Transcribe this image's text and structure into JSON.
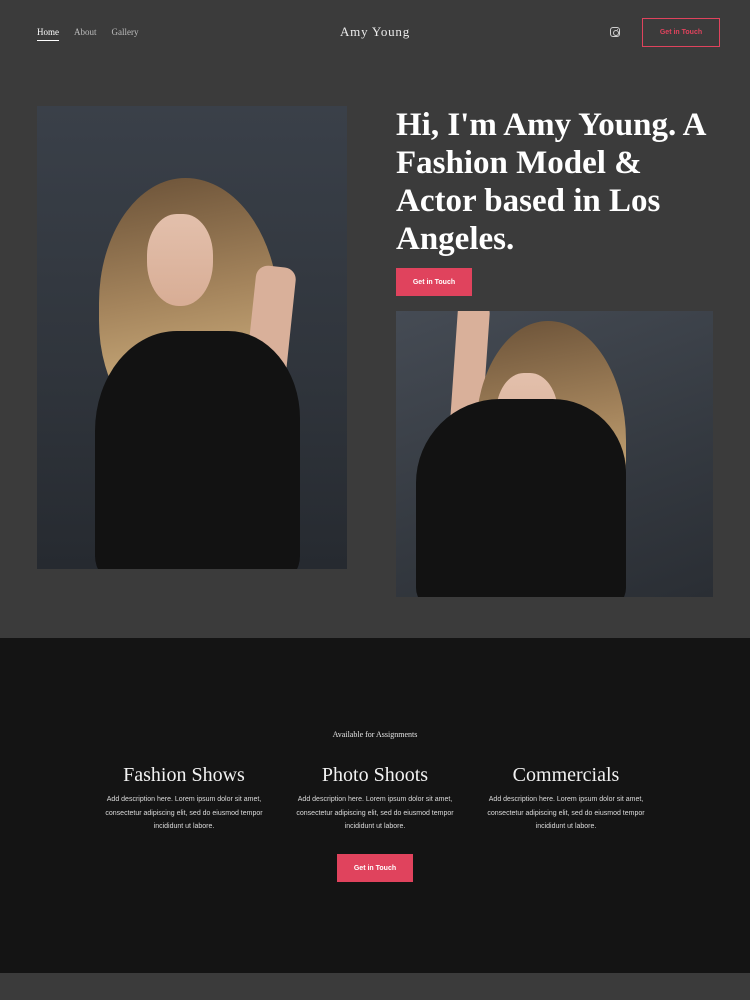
{
  "nav": {
    "items": [
      {
        "label": "Home",
        "active": true
      },
      {
        "label": "About",
        "active": false
      },
      {
        "label": "Gallery",
        "active": false
      }
    ]
  },
  "brand": {
    "name": "Amy Young"
  },
  "header": {
    "cta_label": "Get in Touch",
    "social_icon": "instagram-icon"
  },
  "hero": {
    "title": "Hi, I'm Amy Young. A Fashion Model & Actor based in Los Angeles.",
    "cta_label": "Get in Touch"
  },
  "services": {
    "kicker": "Available for Assignments",
    "items": [
      {
        "title": "Fashion Shows",
        "description": "Add description here. Lorem ipsum dolor sit amet, consectetur adipiscing elit, sed do eiusmod tempor incididunt ut labore."
      },
      {
        "title": "Photo Shoots",
        "description": "Add description here. Lorem ipsum dolor sit amet, consectetur adipiscing elit, sed do eiusmod tempor incididunt ut labore."
      },
      {
        "title": "Commercials",
        "description": "Add description here. Lorem ipsum dolor sit amet, consectetur adipiscing elit, sed do eiusmod tempor incididunt ut labore."
      }
    ],
    "cta_label": "Get in Touch"
  },
  "colors": {
    "accent": "#e0435d",
    "background": "#3b3b3b",
    "dark_section": "#141414"
  }
}
